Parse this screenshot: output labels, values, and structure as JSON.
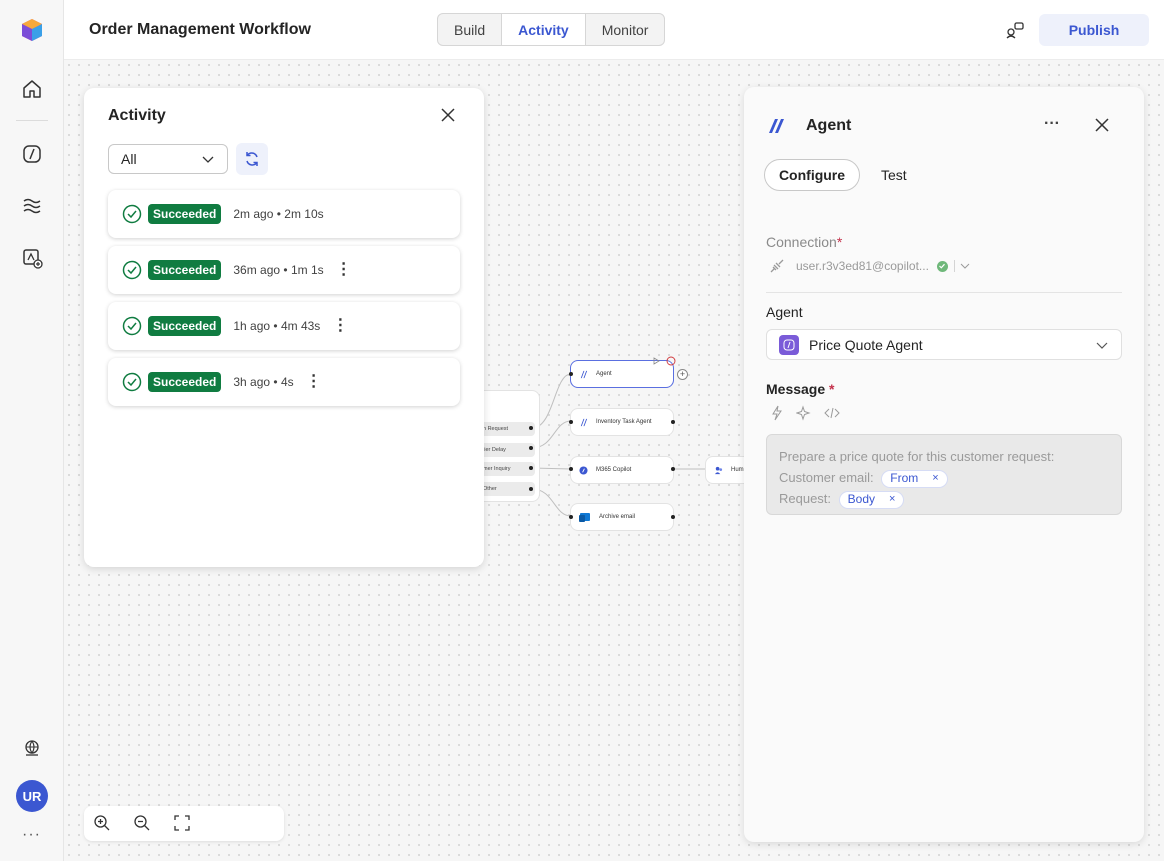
{
  "app": {
    "title": "Order Management Workflow",
    "tabs": [
      "Build",
      "Activity",
      "Monitor"
    ],
    "active_tab": "Activity",
    "publish_label": "Publish",
    "accent_color": "#3b57d1"
  },
  "rail": {
    "icons": [
      "app-logo-icon",
      "home-icon",
      "agents-icon",
      "data-icon",
      "add-app-icon",
      "world-icon"
    ],
    "avatar_initials": "UR",
    "more_label": "···"
  },
  "activity_panel": {
    "title": "Activity",
    "filter_value": "All",
    "runs": [
      {
        "status": "Succeeded",
        "meta": "2m ago • 2m 10s",
        "has_menu": false
      },
      {
        "status": "Succeeded",
        "meta": "36m ago • 1m 1s",
        "has_menu": true
      },
      {
        "status": "Succeeded",
        "meta": "1h ago • 4m 43s",
        "has_menu": true
      },
      {
        "status": "Succeeded",
        "meta": "3h ago • 4s",
        "has_menu": true
      }
    ],
    "status_color": "#107c41",
    "kebab": "⋮"
  },
  "flow": {
    "cases": [
      "n Request",
      "lier Delay",
      "mer Inquiry",
      "Other"
    ],
    "nodes": {
      "agent": "Agent",
      "inventory": "Inventory Task Agent",
      "copilot": "M365 Copilot",
      "archive": "Archive email",
      "human": "Hum"
    }
  },
  "agent_panel": {
    "title": "Agent",
    "more": "···",
    "tabs": [
      "Configure",
      "Test"
    ],
    "active_tab": "Configure",
    "connection_label": "Connection",
    "required_mark": "*",
    "connection_value": "user.r3v3ed81@copilot...",
    "agent_label": "Agent",
    "agent_value": "Price Quote Agent",
    "message_label": "Message",
    "message": {
      "line1": "Prepare a price quote for this customer request:",
      "line2_prefix": "Customer email:",
      "token1": "From",
      "line3_prefix": "Request:",
      "token2": "Body",
      "remove": "×"
    }
  }
}
